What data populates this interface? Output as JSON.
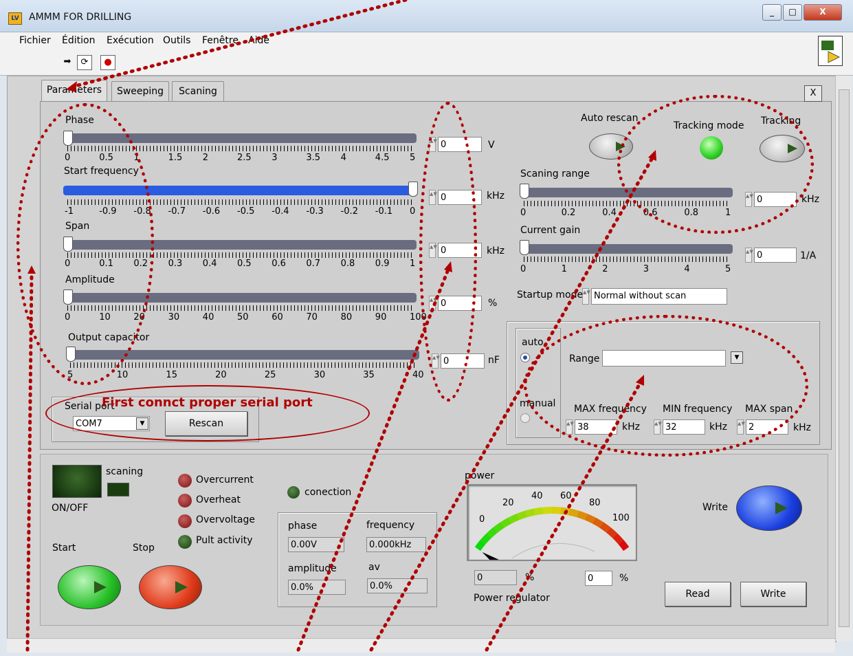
{
  "window": {
    "title": "AMMM FOR DRILLING",
    "min": "_",
    "max": "□",
    "close": "X"
  },
  "menu": {
    "items": [
      "Fichier",
      "Édition",
      "Exécution",
      "Outils",
      "Fenêtre",
      "Aide"
    ]
  },
  "toolbar": {
    "run": "➡",
    "loop": "⟳",
    "stop": "●"
  },
  "tabs": {
    "parameters": "Parameters",
    "sweeping": "Sweeping",
    "scaning": "Scaning",
    "close": "X"
  },
  "sliders": {
    "phase": {
      "label": "Phase",
      "value": "0",
      "unit": "V",
      "scale": [
        "0",
        "0.5",
        "1",
        "1.5",
        "2",
        "2.5",
        "3",
        "3.5",
        "4",
        "4.5",
        "5"
      ]
    },
    "start_frequency": {
      "label": "Start frequency",
      "value": "0",
      "unit": "kHz",
      "scale": [
        "-1",
        "-0.9",
        "-0.8",
        "-0.7",
        "-0.6",
        "-0.5",
        "-0.4",
        "-0.3",
        "-0.2",
        "-0.1",
        "0"
      ]
    },
    "span": {
      "label": "Span",
      "value": "0",
      "unit": "kHz",
      "scale": [
        "0",
        "0.1",
        "0.2",
        "0.3",
        "0.4",
        "0.5",
        "0.6",
        "0.7",
        "0.8",
        "0.9",
        "1"
      ]
    },
    "amplitude": {
      "label": "Amplitude",
      "value": "0",
      "unit": "%",
      "scale": [
        "0",
        "10",
        "20",
        "30",
        "40",
        "50",
        "60",
        "70",
        "80",
        "90",
        "100"
      ]
    },
    "output_capacitor": {
      "label": "Output capacitor",
      "value": "0",
      "unit": "nF",
      "scale": [
        "5",
        "10",
        "15",
        "20",
        "25",
        "30",
        "35",
        "40"
      ]
    },
    "scaning_range": {
      "label": "Scaning range",
      "value": "0",
      "unit": "kHz",
      "scale": [
        "0",
        "0.2",
        "0.4",
        "0.6",
        "0.8",
        "1"
      ]
    },
    "current_gain": {
      "label": "Current gain",
      "value": "0",
      "unit": "1/A",
      "scale": [
        "0",
        "1",
        "2",
        "3",
        "4",
        "5"
      ]
    }
  },
  "auto_rescan": {
    "label": "Auto rescan"
  },
  "tracking_mode": {
    "label": "Tracking mode"
  },
  "tracking": {
    "label": "Tracking"
  },
  "startup_mode": {
    "label": "Startup mode",
    "value": "Normal without scan"
  },
  "range_group": {
    "auto": "auto",
    "manual": "manual",
    "range_label": "Range",
    "range_value": "",
    "max_frequency": {
      "label": "MAX frequency",
      "value": "38",
      "unit": "kHz"
    },
    "min_frequency": {
      "label": "MIN frequency",
      "value": "32",
      "unit": "kHz"
    },
    "max_span": {
      "label": "MAX span",
      "value": "2",
      "unit": "kHz"
    }
  },
  "serial": {
    "label": "Serial port",
    "value": "COM7",
    "rescan": "Rescan",
    "annotation": "First connct proper serial port"
  },
  "bottom": {
    "scaning": "scaning",
    "onoff": "ON/OFF",
    "start": "Start",
    "stop": "Stop",
    "leds": [
      "Overcurrent",
      "Overheat",
      "Overvoltage",
      "Pult activity"
    ],
    "conection": "conection",
    "phase": {
      "label": "phase",
      "value": "0.00V"
    },
    "frequency": {
      "label": "frequency",
      "value": "0.000kHz"
    },
    "amplitude": {
      "label": "amplitude",
      "value": "0.0%"
    },
    "av": {
      "label": "av",
      "value": "0.0%"
    },
    "power": {
      "label": "power",
      "scale": [
        "0",
        "20",
        "40",
        "60",
        "80",
        "100"
      ],
      "value": 0
    },
    "power_field": {
      "value": "0",
      "unit": "%"
    },
    "power_regulator": {
      "label": "Power regulator",
      "value": "0",
      "unit": "%"
    },
    "write_top": "Write",
    "read": "Read",
    "write": "Write"
  },
  "colors": {
    "panel": "#d4d4d4",
    "annotation": "#b00000",
    "led_green_on": "#3ce03c",
    "led_red_off": "#7a1010"
  }
}
